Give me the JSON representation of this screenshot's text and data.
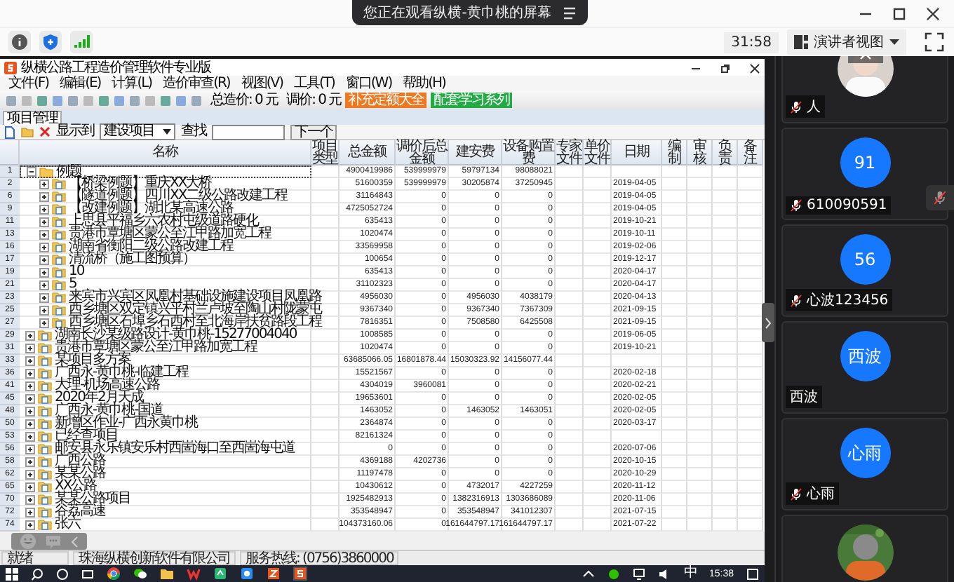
{
  "meeting_bar": {
    "banner": "您正在观看纵横-黄巾桃的屏幕",
    "timer": "31:58",
    "view_mode": "演讲者视图"
  },
  "app": {
    "title": "纵横公路工程造价管理软件专业版",
    "menu": [
      "文件(F)",
      "编辑(E)",
      "计算(L)",
      "造价审查(R)",
      "视图(V)",
      "工具(T)",
      "窗口(W)",
      "帮助(H)"
    ],
    "total_price": "总造价: 0 元",
    "adjusted_price": "调价: 0 元",
    "link_buttons": [
      {
        "label": "补充定额大全",
        "color": "#f07820"
      },
      {
        "label": "配套学习系列",
        "color": "#22aa44"
      }
    ],
    "tabs": [
      {
        "label": "项目管理",
        "selected": true
      }
    ],
    "display_to_label": "显示到",
    "display_to_value": "建设项目",
    "find_label": "查找",
    "next_button": "下一个",
    "table": {
      "columns": [
        "名称",
        "项目类型",
        "总金额",
        "调价后总金额",
        "建安费",
        "设备购置费",
        "专家文件",
        "单价文件",
        "日期",
        "编制",
        "审核",
        "负责",
        "备注"
      ],
      "rows": [
        {
          "num": "1",
          "name": "例题",
          "expanded": true,
          "selected": true,
          "total": "4900419986",
          "adjusted_total": "539999979",
          "construction_cost": "59797134",
          "equipment_cost": "98088021",
          "children": [
            {
              "num": "2",
              "name": "【桥梁例题】重庆XX大桥",
              "expanded": false,
              "selected": false,
              "total": "51600359",
              "adjusted_total": "539999979",
              "construction_cost": "30205874",
              "equipment_cost": "37250945",
              "date": "2019-04-05"
            },
            {
              "num": "6",
              "name": "【隧道例题】四川XX二级公路改建工程",
              "expanded": false,
              "selected": false,
              "total": "31164843",
              "adjusted_total": "0",
              "construction_cost": "0",
              "equipment_cost": "0",
              "date": "2019-04-05"
            },
            {
              "num": "9",
              "name": "【改建例题】湖北某高速公路",
              "expanded": false,
              "selected": false,
              "total": "4725052724",
              "adjusted_total": "0",
              "construction_cost": "0",
              "equipment_cost": "0",
              "date": "2019-04-05"
            },
            {
              "num": "11",
              "name": "上思县平福乡六农村屯级道路硬化",
              "expanded": false,
              "selected": false,
              "total": "635413",
              "adjusted_total": "0",
              "construction_cost": "0",
              "equipment_cost": "0",
              "date": "2019-10-21"
            },
            {
              "num": "13",
              "name": "贵港市覃塘区蒙公至江甲路加宽工程",
              "expanded": false,
              "selected": false,
              "total": "1020474",
              "adjusted_total": "0",
              "construction_cost": "0",
              "equipment_cost": "0",
              "date": "2019-10-11"
            },
            {
              "num": "16",
              "name": "湖南省衡阳二级公路改建工程",
              "expanded": false,
              "selected": false,
              "total": "33569958",
              "adjusted_total": "0",
              "construction_cost": "0",
              "equipment_cost": "0",
              "date": "2019-02-06"
            },
            {
              "num": "17",
              "name": "清流桥（施工图预算）",
              "expanded": false,
              "selected": false,
              "total": "100654",
              "adjusted_total": "0",
              "construction_cost": "0",
              "equipment_cost": "0",
              "date": "2019-12-17"
            },
            {
              "num": "19",
              "name": "10",
              "expanded": false,
              "selected": false,
              "total": "635413",
              "adjusted_total": "0",
              "construction_cost": "0",
              "equipment_cost": "0",
              "date": "2020-04-17"
            },
            {
              "num": "21",
              "name": "5",
              "expanded": false,
              "selected": false,
              "total": "31102323",
              "adjusted_total": "0",
              "construction_cost": "0",
              "equipment_cost": "0",
              "date": "2020-04-17"
            },
            {
              "num": "23",
              "name": "来宾市兴宾区凤凰村基础设施建设项目凤凰路",
              "expanded": false,
              "selected": false,
              "total": "4956030",
              "adjusted_total": "0",
              "construction_cost": "4956030",
              "equipment_cost": "4038179",
              "date": "2020-04-13"
            },
            {
              "num": "25",
              "name": "西乡塘区双定镇兴平村兰卢坡至陶山村陇蒙屯",
              "expanded": false,
              "selected": false,
              "total": "9367340",
              "adjusted_total": "0",
              "construction_cost": "9367340",
              "equipment_cost": "7367309",
              "date": "2021-09-15"
            },
            {
              "num": "27",
              "name": "西乡塘区石埠乡石西村至北海岸扶贫路段工程",
              "expanded": false,
              "selected": false,
              "total": "7816351",
              "adjusted_total": "0",
              "construction_cost": "7508580",
              "equipment_cost": "6425508",
              "date": "2021-09-15"
            }
          ]
        },
        {
          "num": "29",
          "name": "湖南长沙某级路设计-黄巾桃-15277004040",
          "expanded": false,
          "selected": false,
          "total": "1008585",
          "adjusted_total": "0",
          "construction_cost": "0",
          "equipment_cost": "0",
          "date": "2019-06-05"
        },
        {
          "num": "31",
          "name": "贵港市覃塘区蒙公至江甲路加宽工程",
          "expanded": false,
          "selected": false,
          "total": "1020474",
          "adjusted_total": "0",
          "construction_cost": "0",
          "equipment_cost": "0",
          "date": "2019-10-21"
        },
        {
          "num": "33",
          "name": "某项目多方案",
          "expanded": false,
          "selected": false,
          "total": "63685066.05",
          "adjusted_total": "16801878.44",
          "construction_cost": "15030323.92",
          "equipment_cost": "14156077.44"
        },
        {
          "num": "36",
          "name": "广西永-黄巾桃-临建工程",
          "expanded": false,
          "selected": false,
          "total": "15521567",
          "adjusted_total": "0",
          "construction_cost": "0",
          "equipment_cost": "0",
          "date": "2020-02-18"
        },
        {
          "num": "41",
          "name": "大理-机场高速公路",
          "expanded": false,
          "selected": false,
          "total": "4304019",
          "adjusted_total": "3960081",
          "construction_cost": "0",
          "equipment_cost": "0",
          "date": "2020-02-21"
        },
        {
          "num": "45",
          "name": "2020年2月天成",
          "expanded": false,
          "selected": false,
          "total": "19653601",
          "adjusted_total": "0",
          "construction_cost": "0",
          "equipment_cost": "0",
          "date": "2020-02-05"
        },
        {
          "num": "48",
          "name": "广西永-黄巾桃-国道",
          "expanded": false,
          "selected": false,
          "total": "1463052",
          "adjusted_total": "0",
          "construction_cost": "1463052",
          "equipment_cost": "1463051",
          "date": "2020-02-05"
        },
        {
          "num": "50",
          "name": "新增区作业-广西永黄巾桃",
          "expanded": false,
          "selected": false,
          "total": "2364874",
          "adjusted_total": "0",
          "construction_cost": "0",
          "equipment_cost": "0",
          "date": "2020-03-17"
        },
        {
          "num": "53",
          "name": "已经查项目",
          "expanded": false,
          "selected": false,
          "total": "82161324",
          "adjusted_total": "0",
          "construction_cost": "0",
          "equipment_cost": "0"
        },
        {
          "num": "56",
          "name": "邮安县永乐镇安乐村西崮海口至西崮海屯道",
          "expanded": false,
          "selected": false,
          "total": "0",
          "adjusted_total": "0",
          "construction_cost": "0",
          "equipment_cost": "0",
          "date": "2020-07-06"
        },
        {
          "num": "58",
          "name": "广西公路",
          "expanded": false,
          "selected": false,
          "total": "4369188",
          "adjusted_total": "4202736",
          "construction_cost": "0",
          "equipment_cost": "0",
          "date": "2020-10-15"
        },
        {
          "num": "62",
          "name": "某某公路",
          "expanded": false,
          "selected": false,
          "total": "11197478",
          "adjusted_total": "0",
          "construction_cost": "0",
          "equipment_cost": "0",
          "date": "2020-10-29"
        },
        {
          "num": "65",
          "name": "XX公路",
          "expanded": false,
          "selected": false,
          "total": "10430612",
          "adjusted_total": "0",
          "construction_cost": "4732017",
          "equipment_cost": "4227259",
          "date": "2020-11-12"
        },
        {
          "num": "70",
          "name": "某某公路项目",
          "expanded": false,
          "selected": false,
          "total": "1925482913",
          "adjusted_total": "0",
          "construction_cost": "1382316913",
          "equipment_cost": "1303686089",
          "date": "2020-11-06"
        },
        {
          "num": "72",
          "name": "谷荔高速",
          "expanded": false,
          "selected": false,
          "total": "353548947",
          "adjusted_total": "0",
          "construction_cost": "353548947",
          "equipment_cost": "341012307",
          "date": "2021-07-15"
        },
        {
          "num": "74",
          "name": "张六",
          "expanded": false,
          "selected": false,
          "total": "104373160.06",
          "adjusted_total": "0",
          "construction_cost": "161644797.17",
          "equipment_cost": "161644797.17",
          "date": "2021-07-22"
        }
      ]
    },
    "status_bar": [
      "就绪",
      "珠海纵横创新软件有限公司",
      "服务热线: (0756)3860000"
    ]
  },
  "taskbar": {
    "ime": "中",
    "time": "15:38"
  },
  "participants": [
    {
      "kind": "picture",
      "name": "人",
      "muted": true
    },
    {
      "kind": "avatar",
      "avatar": "91",
      "name": "610090591",
      "muted": true
    },
    {
      "kind": "avatar",
      "avatar": "56",
      "name": "心波123456",
      "muted": true
    },
    {
      "kind": "avatar",
      "avatar": "西波",
      "name": "西波",
      "muted": false
    },
    {
      "kind": "avatar",
      "avatar": "心雨",
      "name": "心雨",
      "muted": true
    },
    {
      "kind": "picture"
    }
  ]
}
